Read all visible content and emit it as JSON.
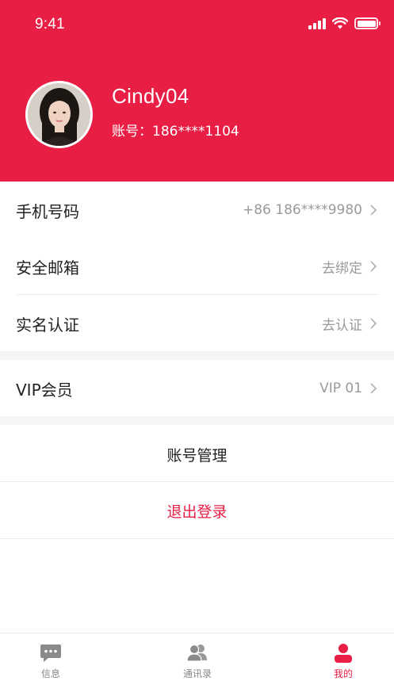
{
  "status_bar": {
    "time": "9:41"
  },
  "profile": {
    "name": "Cindy04",
    "account": "账号：186****1104"
  },
  "info_rows": [
    {
      "label": "手机号码",
      "value": "+86 186****9980"
    },
    {
      "label": "安全邮箱",
      "value": "去绑定"
    },
    {
      "label": "实名认证",
      "value": "去认证"
    }
  ],
  "vip_row": {
    "label": "VIP会员",
    "value": "VIP 01"
  },
  "actions": {
    "manage": "账号管理",
    "logout": "退出登录"
  },
  "tabs": [
    {
      "label": "信息",
      "icon": "chat-bubble-icon"
    },
    {
      "label": "通讯录",
      "icon": "contacts-icon"
    },
    {
      "label": "我的",
      "icon": "person-icon",
      "active": true
    }
  ],
  "colors": {
    "accent": "#E81E45",
    "inactive": "#888888"
  }
}
